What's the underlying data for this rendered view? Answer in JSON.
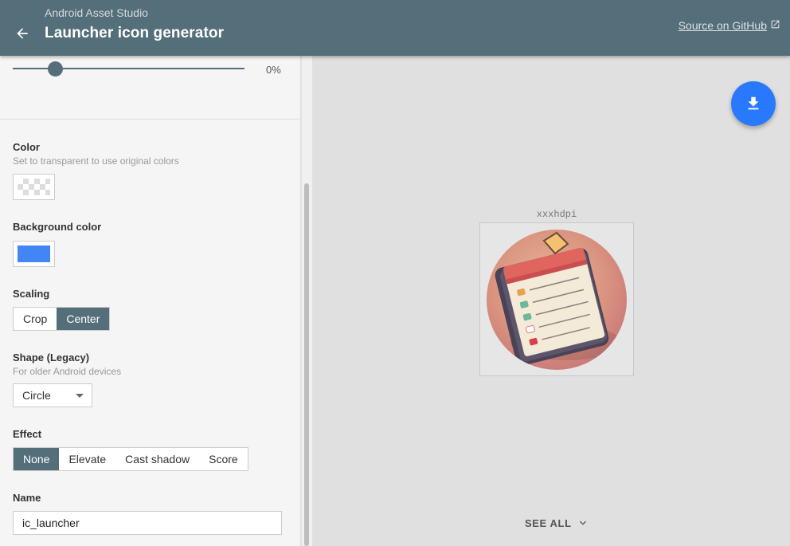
{
  "header": {
    "app_title": "Android Asset Studio",
    "page_title": "Launcher icon generator",
    "github_link": "Source on GitHub"
  },
  "sidebar": {
    "padding_value": "0%",
    "color": {
      "label": "Color",
      "hint": "Set to transparent to use original colors"
    },
    "background_color": {
      "label": "Background color",
      "value": "#4285f4"
    },
    "scaling": {
      "label": "Scaling",
      "options": [
        "Crop",
        "Center"
      ],
      "selected": "Center"
    },
    "shape": {
      "label": "Shape (Legacy)",
      "hint": "For older Android devices",
      "value": "Circle"
    },
    "effect": {
      "label": "Effect",
      "options": [
        "None",
        "Elevate",
        "Cast shadow",
        "Score"
      ],
      "selected": "None"
    },
    "name": {
      "label": "Name",
      "value": "ic_launcher"
    }
  },
  "preview": {
    "density_label": "xxxhdpi",
    "see_all": "SEE ALL"
  },
  "colors": {
    "header": "#546e7a",
    "fab": "#2979ff",
    "background_swatch": "#4285f4"
  }
}
